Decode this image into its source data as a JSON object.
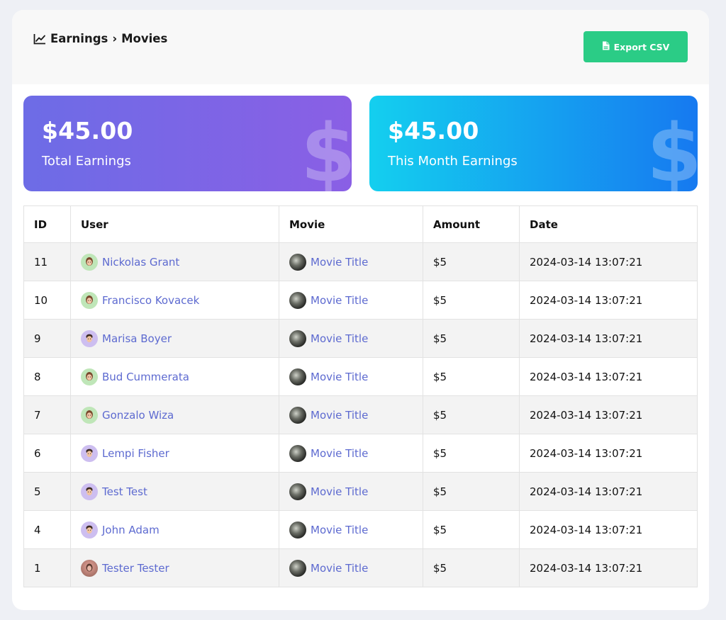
{
  "header": {
    "breadcrumb": [
      "Earnings",
      "Movies"
    ],
    "separator": "›",
    "export_label": "Export CSV"
  },
  "stats": {
    "total": {
      "amount": "$45.00",
      "label": "Total Earnings"
    },
    "month": {
      "amount": "$45.00",
      "label": "This Month Earnings"
    },
    "watermark": "$"
  },
  "table": {
    "columns": [
      "ID",
      "User",
      "Movie",
      "Amount",
      "Date"
    ],
    "rows": [
      {
        "id": "11",
        "user": "Nickolas Grant",
        "avatar": "green",
        "movie": "Movie Title",
        "amount": "$5",
        "date": "2024-03-14 13:07:21"
      },
      {
        "id": "10",
        "user": "Francisco Kovacek",
        "avatar": "green",
        "movie": "Movie Title",
        "amount": "$5",
        "date": "2024-03-14 13:07:21"
      },
      {
        "id": "9",
        "user": "Marisa Boyer",
        "avatar": "purple",
        "movie": "Movie Title",
        "amount": "$5",
        "date": "2024-03-14 13:07:21"
      },
      {
        "id": "8",
        "user": "Bud Cummerata",
        "avatar": "green",
        "movie": "Movie Title",
        "amount": "$5",
        "date": "2024-03-14 13:07:21"
      },
      {
        "id": "7",
        "user": "Gonzalo Wiza",
        "avatar": "green",
        "movie": "Movie Title",
        "amount": "$5",
        "date": "2024-03-14 13:07:21"
      },
      {
        "id": "6",
        "user": "Lempi Fisher",
        "avatar": "purple",
        "movie": "Movie Title",
        "amount": "$5",
        "date": "2024-03-14 13:07:21"
      },
      {
        "id": "5",
        "user": "Test Test",
        "avatar": "purple",
        "movie": "Movie Title",
        "amount": "$5",
        "date": "2024-03-14 13:07:21"
      },
      {
        "id": "4",
        "user": "John Adam",
        "avatar": "purple",
        "movie": "Movie Title",
        "amount": "$5",
        "date": "2024-03-14 13:07:21"
      },
      {
        "id": "1",
        "user": "Tester Tester",
        "avatar": "photo",
        "movie": "Movie Title",
        "amount": "$5",
        "date": "2024-03-14 13:07:21"
      }
    ]
  },
  "colors": {
    "export_button": "#2bcc86",
    "total_card_start": "#6d6ce6",
    "total_card_end": "#8a5fe5",
    "month_card_start": "#14cfef",
    "month_card_end": "#1679f0",
    "link": "#5d6ad0"
  },
  "icons": {
    "breadcrumb": "line-chart-icon",
    "export": "csv-file-icon",
    "stat_watermark": "dollar-icon"
  }
}
